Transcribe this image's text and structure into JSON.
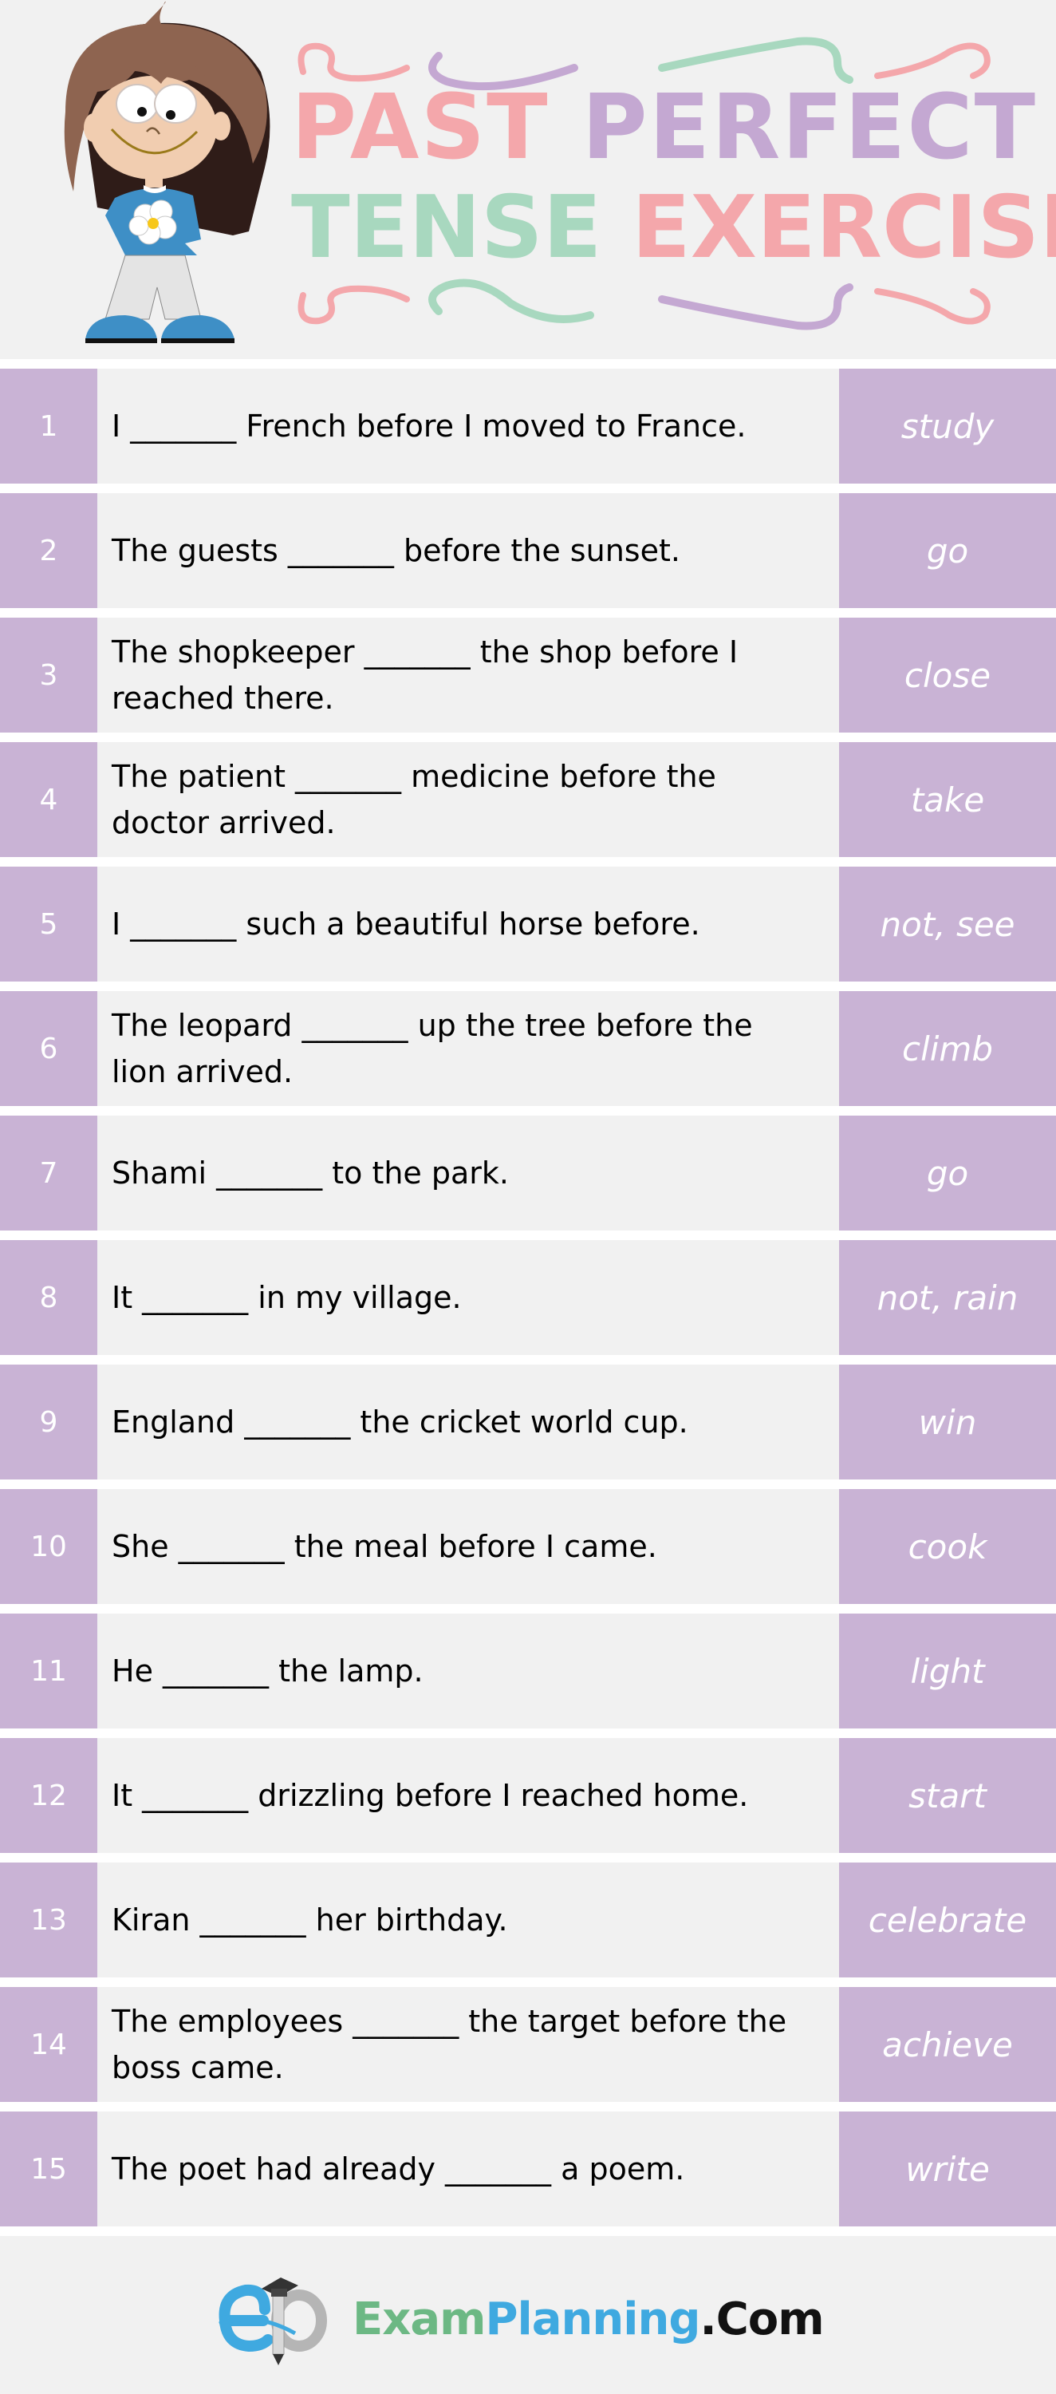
{
  "header": {
    "title_words": [
      {
        "text": "PAST",
        "color": "#f4a7ab"
      },
      {
        "text": "PERFECT",
        "color": "#c4a8d2"
      },
      {
        "text": "TENSE",
        "color": "#a8d8bf"
      },
      {
        "text": "EXERCISE",
        "color": "#f4a7ab"
      }
    ],
    "illustration": "cartoon-girl"
  },
  "colors": {
    "accent_lavender": "#c9b3d5",
    "row_background": "#f1f1f1",
    "title_pink": "#f4a7ab",
    "title_lavender": "#c4a8d2",
    "title_mint": "#a8d8bf"
  },
  "exercises": [
    {
      "num": "1",
      "sentence": "I _______ French before I moved to France.",
      "verb": "study"
    },
    {
      "num": "2",
      "sentence": "The guests _______ before the sunset.",
      "verb": "go"
    },
    {
      "num": "3",
      "sentence": "The shopkeeper _______ the shop before I reached there.",
      "verb": "close"
    },
    {
      "num": "4",
      "sentence": "The patient _______ medicine before the doctor arrived.",
      "verb": "take"
    },
    {
      "num": "5",
      "sentence": "I _______ such a beautiful horse before.",
      "verb": "not, see"
    },
    {
      "num": "6",
      "sentence": "The leopard _______ up the tree before the lion arrived.",
      "verb": "climb"
    },
    {
      "num": "7",
      "sentence": "Shami _______ to the park.",
      "verb": "go"
    },
    {
      "num": "8",
      "sentence": "It _______ in my village.",
      "verb": "not, rain"
    },
    {
      "num": "9",
      "sentence": "England _______ the cricket world cup.",
      "verb": "win"
    },
    {
      "num": "10",
      "sentence": "She _______ the meal before I came.",
      "verb": "cook"
    },
    {
      "num": "11",
      "sentence": "He _______ the lamp.",
      "verb": "light"
    },
    {
      "num": "12",
      "sentence": "It _______ drizzling before I reached home.",
      "verb": "start"
    },
    {
      "num": "13",
      "sentence": "Kiran _______ her birthday.",
      "verb": "celebrate"
    },
    {
      "num": "14",
      "sentence": "The employees _______ the target before the boss came.",
      "verb": "achieve"
    },
    {
      "num": "15",
      "sentence": "The poet had already _______ a poem.",
      "verb": "write"
    }
  ],
  "footer": {
    "brand_part1": "Exam",
    "brand_part2": "Planning",
    "brand_part3": ".Com",
    "logo_icon": "ep-pencil-graduation-cap-logo"
  }
}
